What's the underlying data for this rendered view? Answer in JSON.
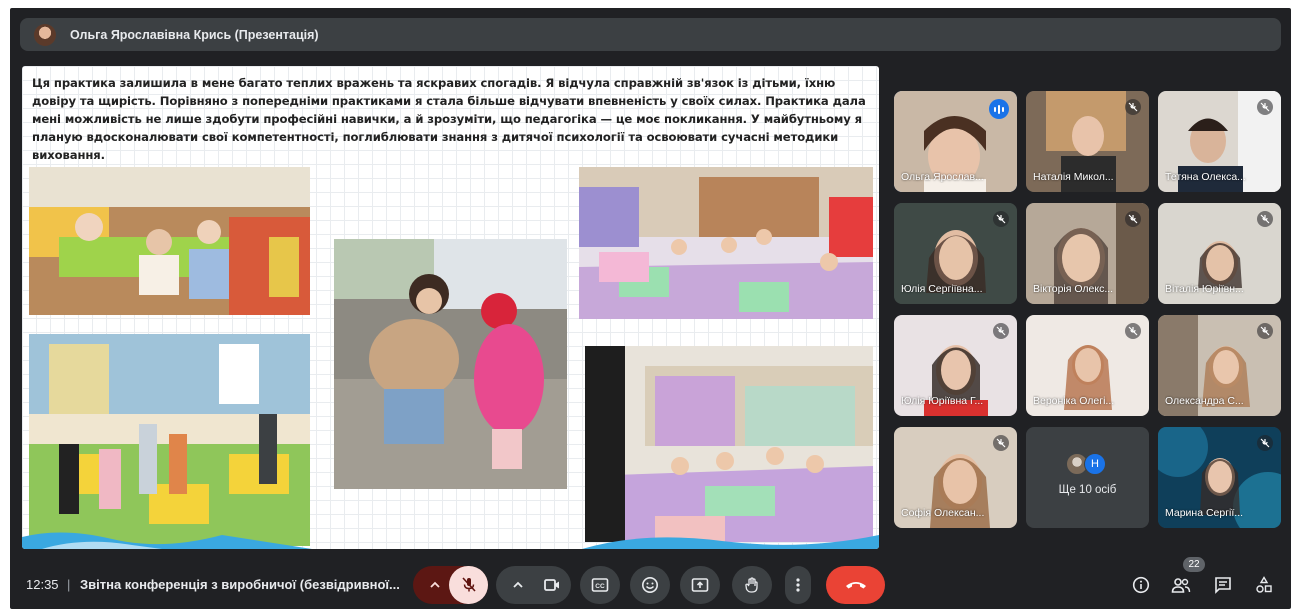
{
  "presenter": {
    "name": "Ольга Ярославівна Крись (Презентація)"
  },
  "slide": {
    "text": "Ця практика залишила в мене багато теплих вражень та яскравих спогадів. Я відчула справжній зв'язок із дітьми, їхню довіру та щирість. Порівняно з попередніми практиками я стала більше відчувати  впевненість у своїх силах. Практика дала мені можливість не лише здобути професійні навички, а й зрозуміти, що педагогіка — це моє покликання. У майбутньому я планую вдосконалювати свої компетентності, поглиблювати знання з дитячої психології та освоювати сучасні методики виховання."
  },
  "participants": [
    {
      "name": "Ольга Ярослав...",
      "speaking": true
    },
    {
      "name": "Наталія Микол...",
      "muted": true
    },
    {
      "name": "Тетяна Олекса...",
      "muted": true
    },
    {
      "name": "Юлія Сергіївна...",
      "muted": true
    },
    {
      "name": "Вікторія Олекс...",
      "muted": true
    },
    {
      "name": "Віталія Юріївн...",
      "muted": true
    },
    {
      "name": "Юлія Юріївна Г...",
      "muted": true
    },
    {
      "name": "Вероніка Олегі...",
      "muted": true
    },
    {
      "name": "Олександра С...",
      "muted": true
    },
    {
      "name": "Софія Олексан...",
      "muted": true
    },
    {
      "name": "Марина Сергії...",
      "muted": true
    }
  ],
  "more_participants": {
    "avatar_letter": "Н",
    "label": "Ще 10 осіб"
  },
  "bottom_bar": {
    "time": "12:35",
    "separator": "|",
    "meeting_title": "Звітна конференція з виробничої (безвідривної...",
    "people_count": "22"
  },
  "icons": {
    "mic": "mic-off-icon",
    "camera": "video-icon",
    "captions": "closed-captions-icon",
    "emoji": "emoji-icon",
    "present": "present-screen-icon",
    "hand": "raise-hand-icon",
    "more": "more-vert-icon",
    "leave": "call-end-icon",
    "info": "info-icon",
    "people": "people-icon",
    "chat": "chat-icon",
    "activities": "activities-icon"
  },
  "colors": {
    "background": "#202124",
    "surface": "#3c4043",
    "leave": "#ea4335",
    "mic_off_bg": "#f9dedc",
    "speaking": "#1a73e8",
    "active_outline": "#8ab4f8"
  }
}
